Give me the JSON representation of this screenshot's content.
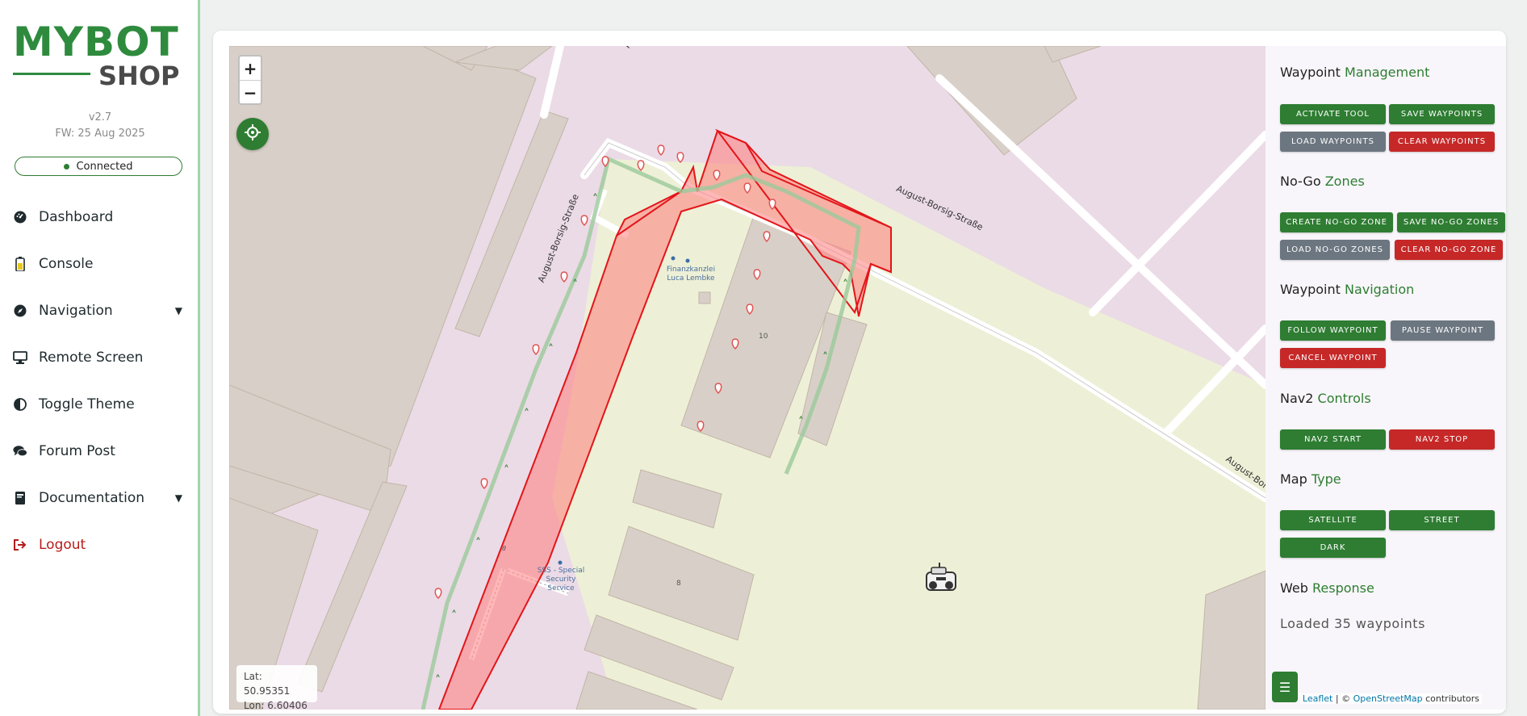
{
  "logo": {
    "top": "MYBOT",
    "bottom": "SHOP"
  },
  "version": "v2.7",
  "firmware": "FW: 25 Aug 2025",
  "status": "Connected",
  "nav": {
    "dashboard": "Dashboard",
    "console": "Console",
    "navigation": "Navigation",
    "remote_screen": "Remote Screen",
    "toggle_theme": "Toggle Theme",
    "forum_post": "Forum Post",
    "documentation": "Documentation",
    "logout": "Logout"
  },
  "map": {
    "zoom_in": "+",
    "zoom_out": "−",
    "lat_label": "Lat: 50.95351",
    "lon_label": "Lon: 6.60406",
    "street_1": "August-Borsig-Straße",
    "street_2": "August-Borsig-Straße",
    "street_3": "August-Borsig-Str",
    "street_4": "Au",
    "poi_1_line1": "Finanzkanzlei",
    "poi_1_line2": "Luca Lembke",
    "poi_2_line1": "SSS - Special",
    "poi_2_line2": "Security",
    "poi_2_line3": "Service",
    "house_10": "10",
    "house_8": "8",
    "road_no": "8",
    "attribution_leaflet": "Leaflet",
    "attribution_sep": " | © ",
    "attribution_osm": "OpenStreetMap",
    "attribution_rest": " contributors"
  },
  "panel": {
    "waypoint_mgmt": {
      "title_a": "Waypoint",
      "title_b": "Management",
      "activate": "Activate Tool",
      "save": "Save Waypoints",
      "load": "Load Waypoints",
      "clear": "Clear Waypoints"
    },
    "nogo": {
      "title_a": "No-Go",
      "title_b": "Zones",
      "create": "Create No-Go Zone",
      "save": "Save No-Go Zones",
      "load": "Load No-Go Zones",
      "clear": "Clear No-Go Zone"
    },
    "waypoint_nav": {
      "title_a": "Waypoint",
      "title_b": "Navigation",
      "follow": "Follow Waypoint",
      "pause": "Pause Waypoint",
      "cancel": "Cancel Waypoint"
    },
    "nav2": {
      "title_a": "Nav2",
      "title_b": "Controls",
      "start": "Nav2 Start",
      "stop": "Nav2 Stop"
    },
    "map_type": {
      "title_a": "Map",
      "title_b": "Type",
      "satellite": "Satellite",
      "street": "Street",
      "dark": "Dark"
    },
    "web_response": {
      "title_a": "Web",
      "title_b": "Response",
      "message": "Loaded 35 waypoints"
    },
    "menu_icon": "☰"
  },
  "colors": {
    "accent": "#2e7d32",
    "danger": "#c62828",
    "neutral": "#6c7680"
  }
}
